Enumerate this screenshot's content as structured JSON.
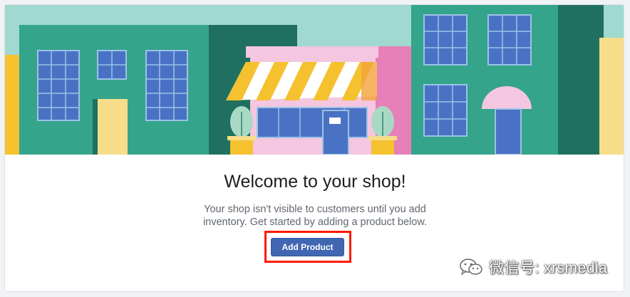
{
  "welcome": {
    "title": "Welcome to your shop!",
    "description": "Your shop isn't visible to customers until you add inventory. Get started by adding a product below.",
    "add_product_label": "Add Product"
  },
  "watermark": {
    "text": "微信号: xrsmedia",
    "icon": "wechat-icon"
  },
  "colors": {
    "button": "#4267b2",
    "highlight": "#ff1a00",
    "sky": "#a0d9d0",
    "building_green": "#34a48a",
    "building_dark": "#1f7060",
    "awning_yellow": "#f5c12e",
    "shop_pink": "#f5c6e0"
  }
}
